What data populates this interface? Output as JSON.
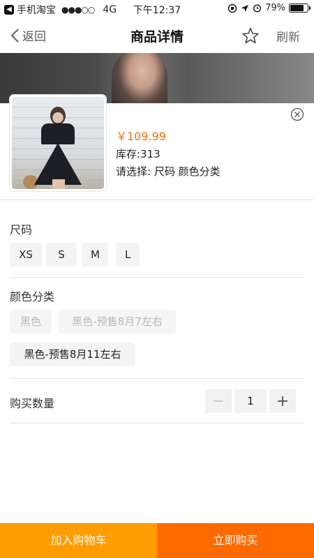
{
  "status_bar": {
    "carrier": "手机淘宝",
    "signal": "●●●○○",
    "network": "4G",
    "time": "下午12:37",
    "battery": "79%",
    "battery_level": 0.79
  },
  "nav": {
    "back_label": "返回",
    "title": "商品详情",
    "refresh_label": "刷新"
  },
  "product": {
    "price": "￥109.99",
    "stock": "库存:313",
    "select_hint": "请选择: 尺码 颜色分类"
  },
  "size": {
    "title": "尺码",
    "options": [
      "XS",
      "S",
      "M",
      "L"
    ]
  },
  "color": {
    "title": "颜色分类",
    "options": [
      "黑色",
      "黑色-预售8月7左右",
      "黑色-预售8月11左右"
    ]
  },
  "quantity": {
    "label": "购买数量",
    "value": "1",
    "minus": "−",
    "plus": "+"
  },
  "actions": {
    "add_to_cart": "加入购物车",
    "buy_now": "立即购买"
  },
  "colors": {
    "accent_orange": "#ff6a00",
    "cart_orange": "#ff9c00",
    "price_orange": "#f26d12"
  }
}
